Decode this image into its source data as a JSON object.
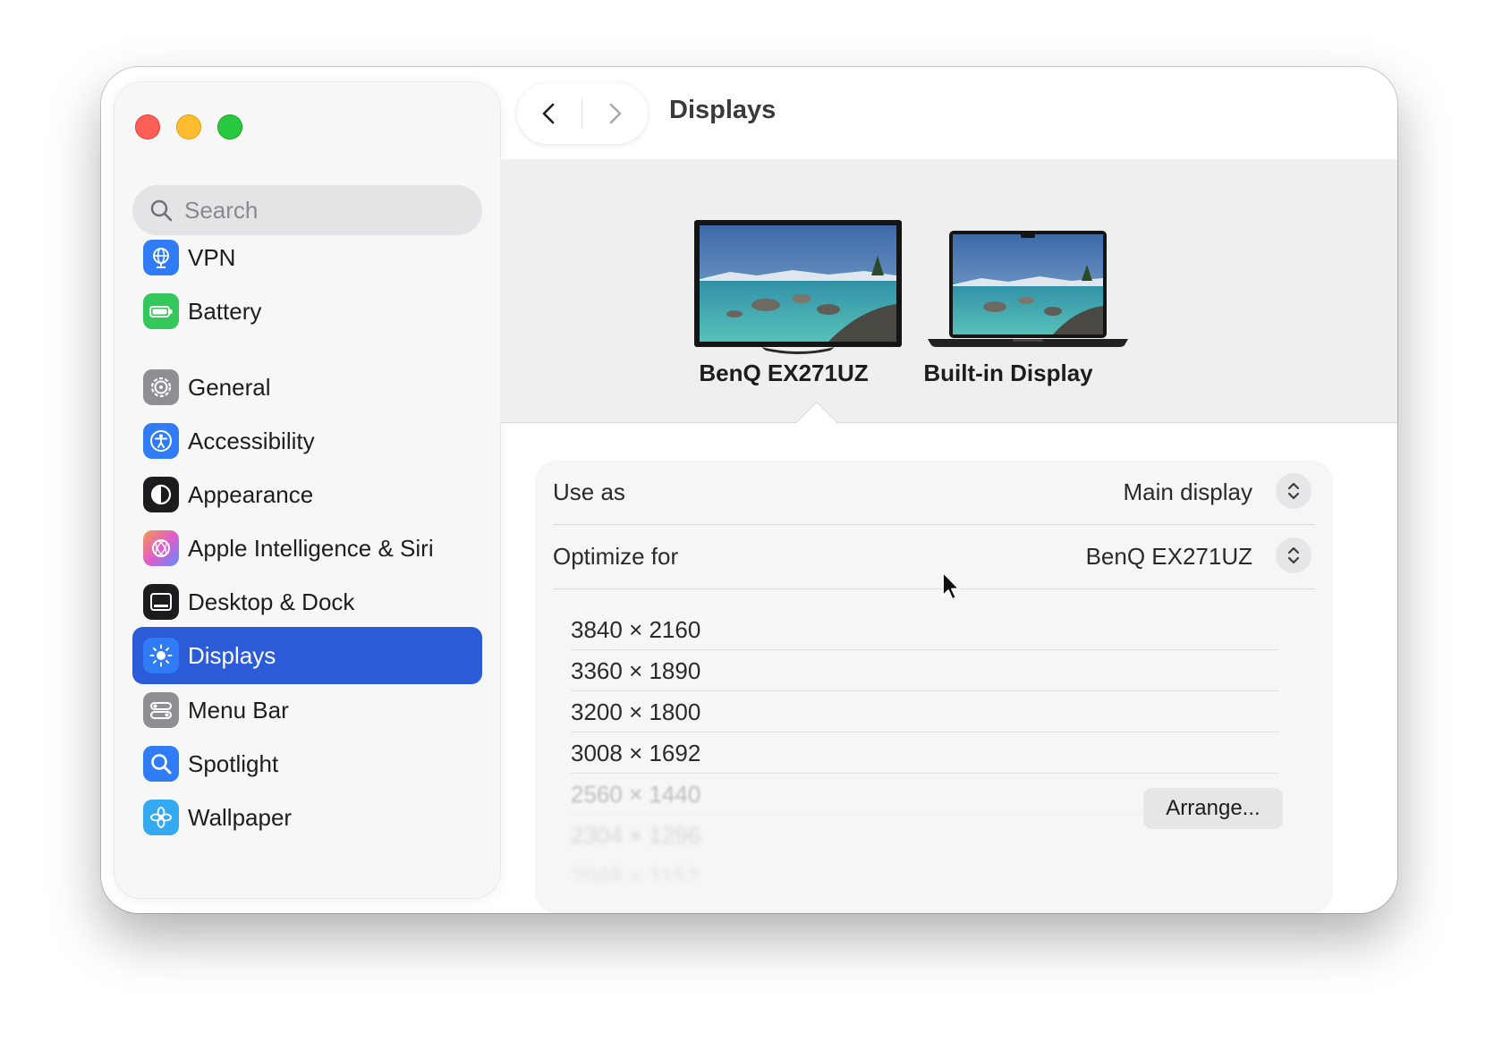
{
  "window": {
    "title": "Displays",
    "controls": {
      "close": "close-button",
      "minimize": "minimize-button",
      "zoom": "zoom-button"
    }
  },
  "search": {
    "placeholder": "Search",
    "icon": "magnifier-icon"
  },
  "sidebar": {
    "items": [
      {
        "label": "VPN",
        "icon": "vpn-globe-icon",
        "icon_color": "#2f7cf6",
        "active": false
      },
      {
        "label": "Battery",
        "icon": "battery-icon",
        "icon_color": "#34c759",
        "active": false
      },
      {
        "label": "General",
        "icon": "gear-icon",
        "icon_color": "#8e8e93",
        "active": false
      },
      {
        "label": "Accessibility",
        "icon": "accessibility-icon",
        "icon_color": "#2f7cf6",
        "active": false
      },
      {
        "label": "Appearance",
        "icon": "appearance-icon",
        "icon_color": "#1c1c1e",
        "active": false
      },
      {
        "label": "Apple Intelligence & Siri",
        "icon": "siri-icon",
        "icon_color": "#f2994a",
        "active": false
      },
      {
        "label": "Desktop & Dock",
        "icon": "dock-icon",
        "icon_color": "#1c1c1e",
        "active": false
      },
      {
        "label": "Displays",
        "icon": "sun-icon",
        "icon_color": "#2f7cf6",
        "active": true
      },
      {
        "label": "Menu Bar",
        "icon": "menubar-icon",
        "icon_color": "#8e8e93",
        "active": false
      },
      {
        "label": "Spotlight",
        "icon": "spotlight-icon",
        "icon_color": "#2f7cf6",
        "active": false
      },
      {
        "label": "Wallpaper",
        "icon": "wallpaper-icon",
        "icon_color": "#35aaf0",
        "active": false
      }
    ]
  },
  "displays": [
    {
      "name": "BenQ EX271UZ",
      "kind": "external-monitor",
      "selected": true
    },
    {
      "name": "Built-in Display",
      "kind": "laptop",
      "selected": false
    }
  ],
  "settings": {
    "use_as": {
      "label": "Use as",
      "value": "Main display"
    },
    "optimize_for": {
      "label": "Optimize for",
      "value": "BenQ EX271UZ"
    },
    "resolutions": [
      "3840 × 2160",
      "3360 × 1890",
      "3200 × 1800",
      "3008 × 1692",
      "2560 × 1440",
      "2304 × 1296",
      "2048 × 1152"
    ]
  },
  "buttons": {
    "arrange": "Arrange..."
  },
  "colors": {
    "accent": "#2c5bd8",
    "sidebar_bg": "#f7f7f7",
    "strip_bg": "#efefef"
  }
}
